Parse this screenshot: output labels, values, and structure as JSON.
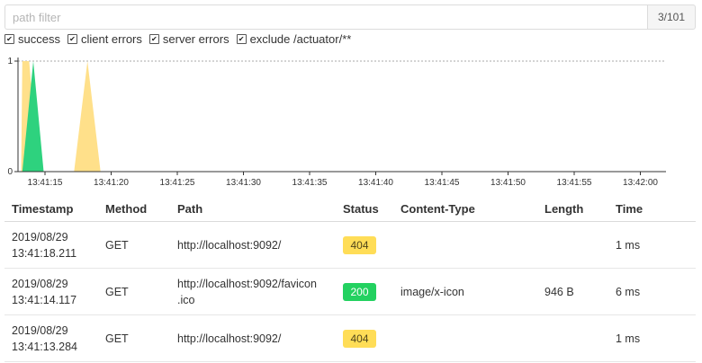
{
  "filter": {
    "placeholder": "path filter",
    "count": "3/101"
  },
  "checkboxes": [
    {
      "label": "success",
      "checked": true
    },
    {
      "label": "client errors",
      "checked": true
    },
    {
      "label": "server errors",
      "checked": true
    },
    {
      "label": "exclude /actuator/**",
      "checked": true
    }
  ],
  "chart_data": {
    "type": "area",
    "x_tick_labels": [
      "13:41:15",
      "13:41:20",
      "13:41:25",
      "13:41:30",
      "13:41:35",
      "13:41:40",
      "13:41:45",
      "13:41:50",
      "13:41:55",
      "13:42:00"
    ],
    "y_tick_labels": [
      "0",
      "1"
    ],
    "ylim": [
      0,
      1
    ],
    "max_line": 1,
    "series": [
      {
        "color": "#ffe08a",
        "points": [
          [
            "13:41:13.2",
            0
          ],
          [
            "13:41:13.284",
            1
          ],
          [
            "13:41:13.8",
            1
          ],
          [
            "13:41:14.5",
            0
          ],
          [
            "13:41:17.2",
            0
          ],
          [
            "13:41:18.211",
            1
          ],
          [
            "13:41:19.2",
            0
          ]
        ]
      },
      {
        "color": "#2ed27e",
        "points": [
          [
            "13:41:13.284",
            0
          ],
          [
            "13:41:14.117",
            1
          ],
          [
            "13:41:14.9",
            0
          ]
        ]
      }
    ]
  },
  "table": {
    "headers": [
      "Timestamp",
      "Method",
      "Path",
      "Status",
      "Content-Type",
      "Length",
      "Time"
    ],
    "rows": [
      {
        "date": "2019/08/29",
        "time": "13:41:18.211",
        "method": "GET",
        "path": "http://localhost:9092/",
        "path2": "",
        "status": "404",
        "status_color": "#ffdd57",
        "content_type": "",
        "length": "",
        "duration": "1 ms"
      },
      {
        "date": "2019/08/29",
        "time": "13:41:14.117",
        "method": "GET",
        "path": "http://localhost:9092/favicon",
        "path2": ".ico",
        "status": "200",
        "status_color": "#23d160",
        "content_type": "image/x-icon",
        "length": "946 B",
        "duration": "6 ms"
      },
      {
        "date": "2019/08/29",
        "time": "13:41:13.284",
        "method": "GET",
        "path": "http://localhost:9092/",
        "path2": "",
        "status": "404",
        "status_color": "#ffdd57",
        "content_type": "",
        "length": "",
        "duration": "1 ms"
      }
    ]
  }
}
